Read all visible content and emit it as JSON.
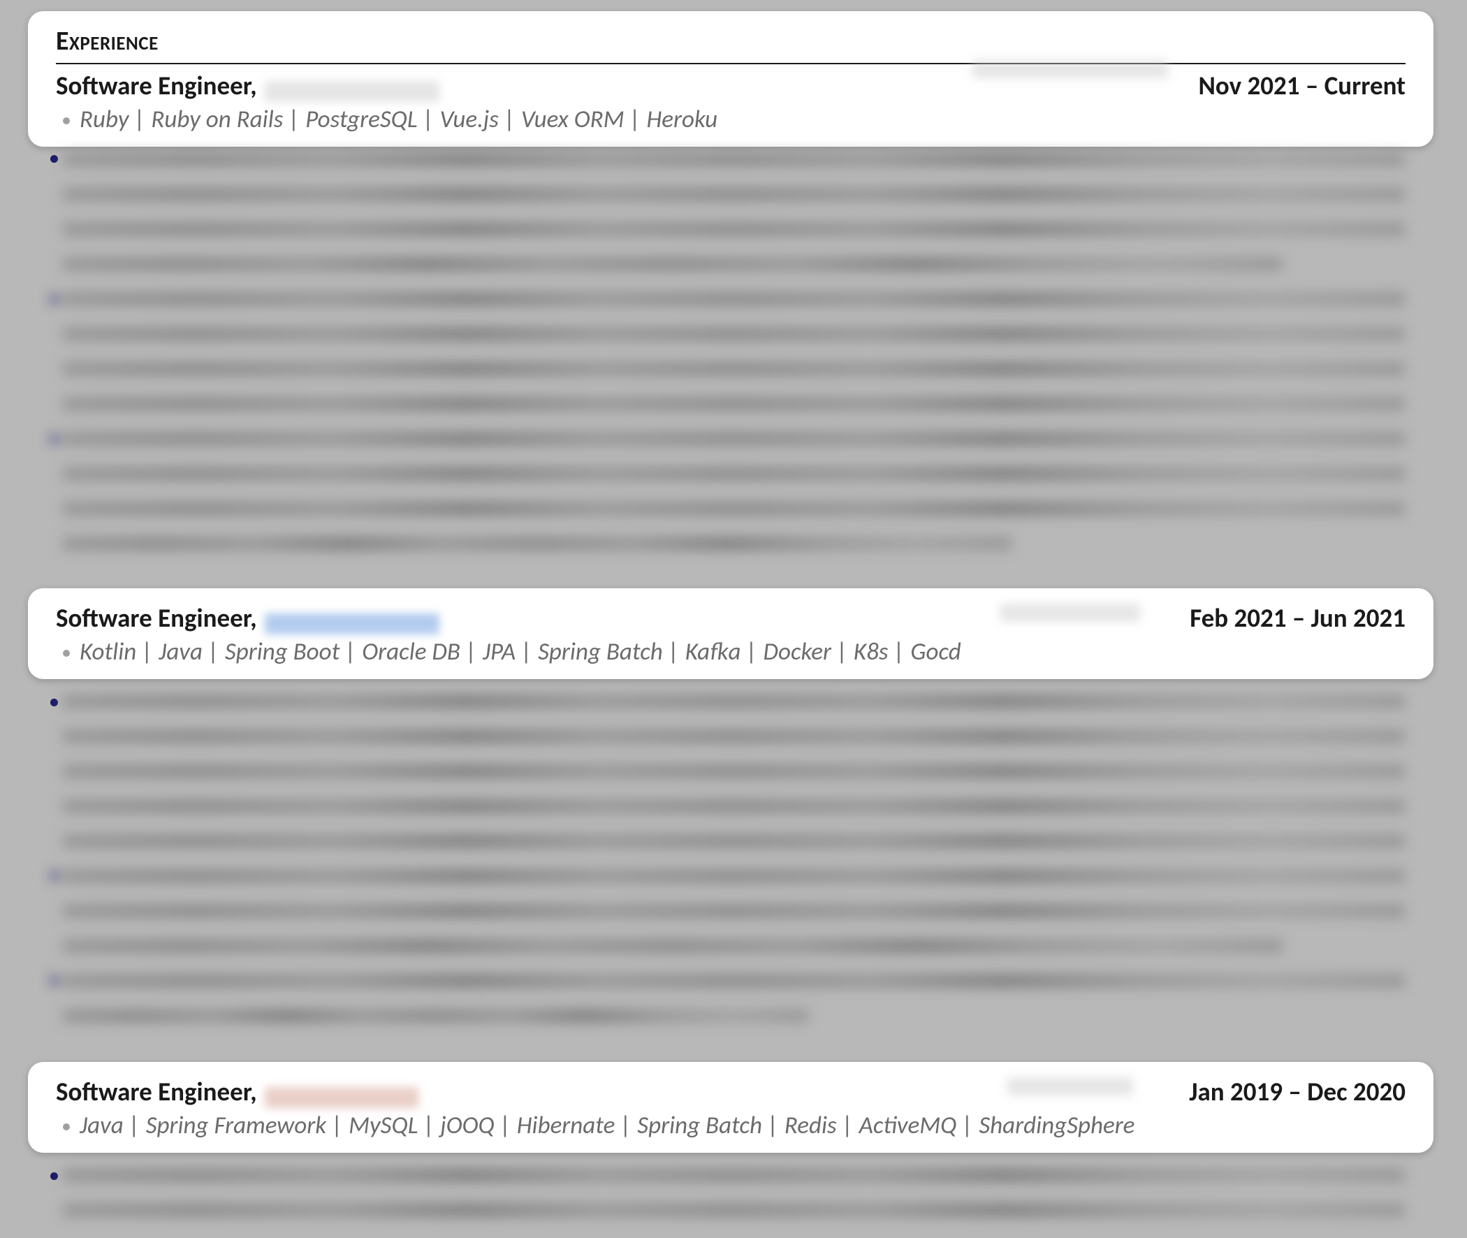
{
  "section_header": "Experience",
  "jobs": [
    {
      "title": "Software Engineer,",
      "dates": "Nov 2021 – Current",
      "tech": "Ruby | Ruby on Rails | PostgreSQL | Vue.js | Vuex ORM | Heroku"
    },
    {
      "title": "Software Engineer,",
      "dates": "Feb 2021 – Jun 2021",
      "tech": "Kotlin |  Java | Spring Boot | Oracle DB | JPA | Spring Batch | Kafka | Docker | K8s | Gocd"
    },
    {
      "title": "Software Engineer,",
      "dates": "Jan 2019 – Dec 2020",
      "tech": "Java | Spring Framework | MySQL  | jOOQ | Hibernate | Spring Batch | Redis | ActiveMQ | ShardingSphere"
    }
  ]
}
